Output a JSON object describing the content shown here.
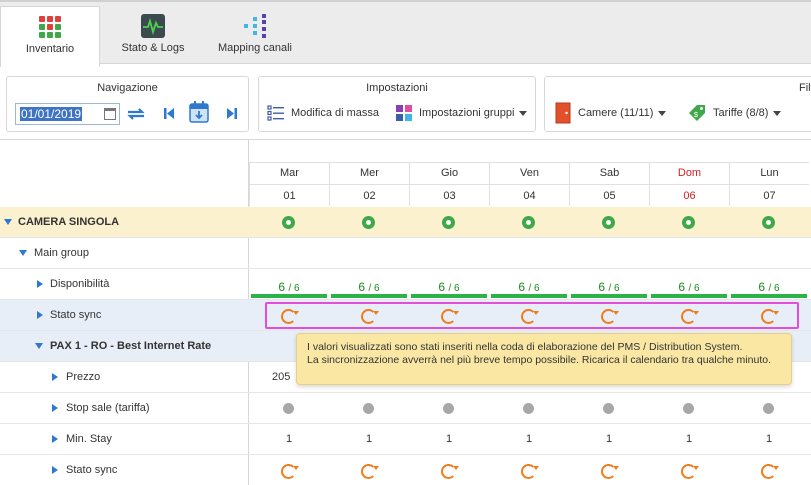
{
  "tabs": [
    {
      "label": "Inventario",
      "icon": "grid-icon",
      "active": true
    },
    {
      "label": "Stato & Logs",
      "icon": "pulse-monitor-icon"
    },
    {
      "label": "Mapping canali",
      "icon": "mapping-icon"
    }
  ],
  "toolbar": {
    "navigation": {
      "title": "Navigazione",
      "date_value": "01/01/2019"
    },
    "settings": {
      "title": "Impostazioni",
      "bulk_edit": "Modifica di massa",
      "group_settings": "Impostazioni gruppi"
    },
    "filters": {
      "title": "Filt",
      "rooms": "Camere (11/11)",
      "rates": "Tariffe (8/8)"
    }
  },
  "days": [
    {
      "name": "Mar",
      "date": "01"
    },
    {
      "name": "Mer",
      "date": "02"
    },
    {
      "name": "Gio",
      "date": "03"
    },
    {
      "name": "Ven",
      "date": "04"
    },
    {
      "name": "Sab",
      "date": "05"
    },
    {
      "name": "Dom",
      "date": "06",
      "sunday": true
    },
    {
      "name": "Lun",
      "date": "07"
    }
  ],
  "rows": {
    "room": "CAMERA SINGOLA",
    "main_group": "Main group",
    "availability": "Disponibilità",
    "availability_value": "6",
    "availability_total": "/ 6",
    "sync_status": "Stato sync",
    "rate": "PAX 1 - RO - Best Internet Rate",
    "price": "Prezzo",
    "price_first": "205",
    "stop_sale": "Stop sale (tariffa)",
    "min_stay": "Min. Stay",
    "min_stay_value": "1",
    "rate_sync_status": "Stato sync"
  },
  "tooltip": {
    "line1": "I valori visualizzati sono stati inseriti nella coda di elaborazione del PMS / Distribution System.",
    "line2": "La sincronizzazione avverrà nel più breve tempo possibile. Ricarica il calendario tra qualche minuto."
  },
  "colors": {
    "accent": "#2f78d0",
    "sync": "#ef7d1a",
    "available": "#2bb34a",
    "sunday": "#d21f1f",
    "highlight": "#e24ddb",
    "tooltip": "#fbe7a4"
  }
}
